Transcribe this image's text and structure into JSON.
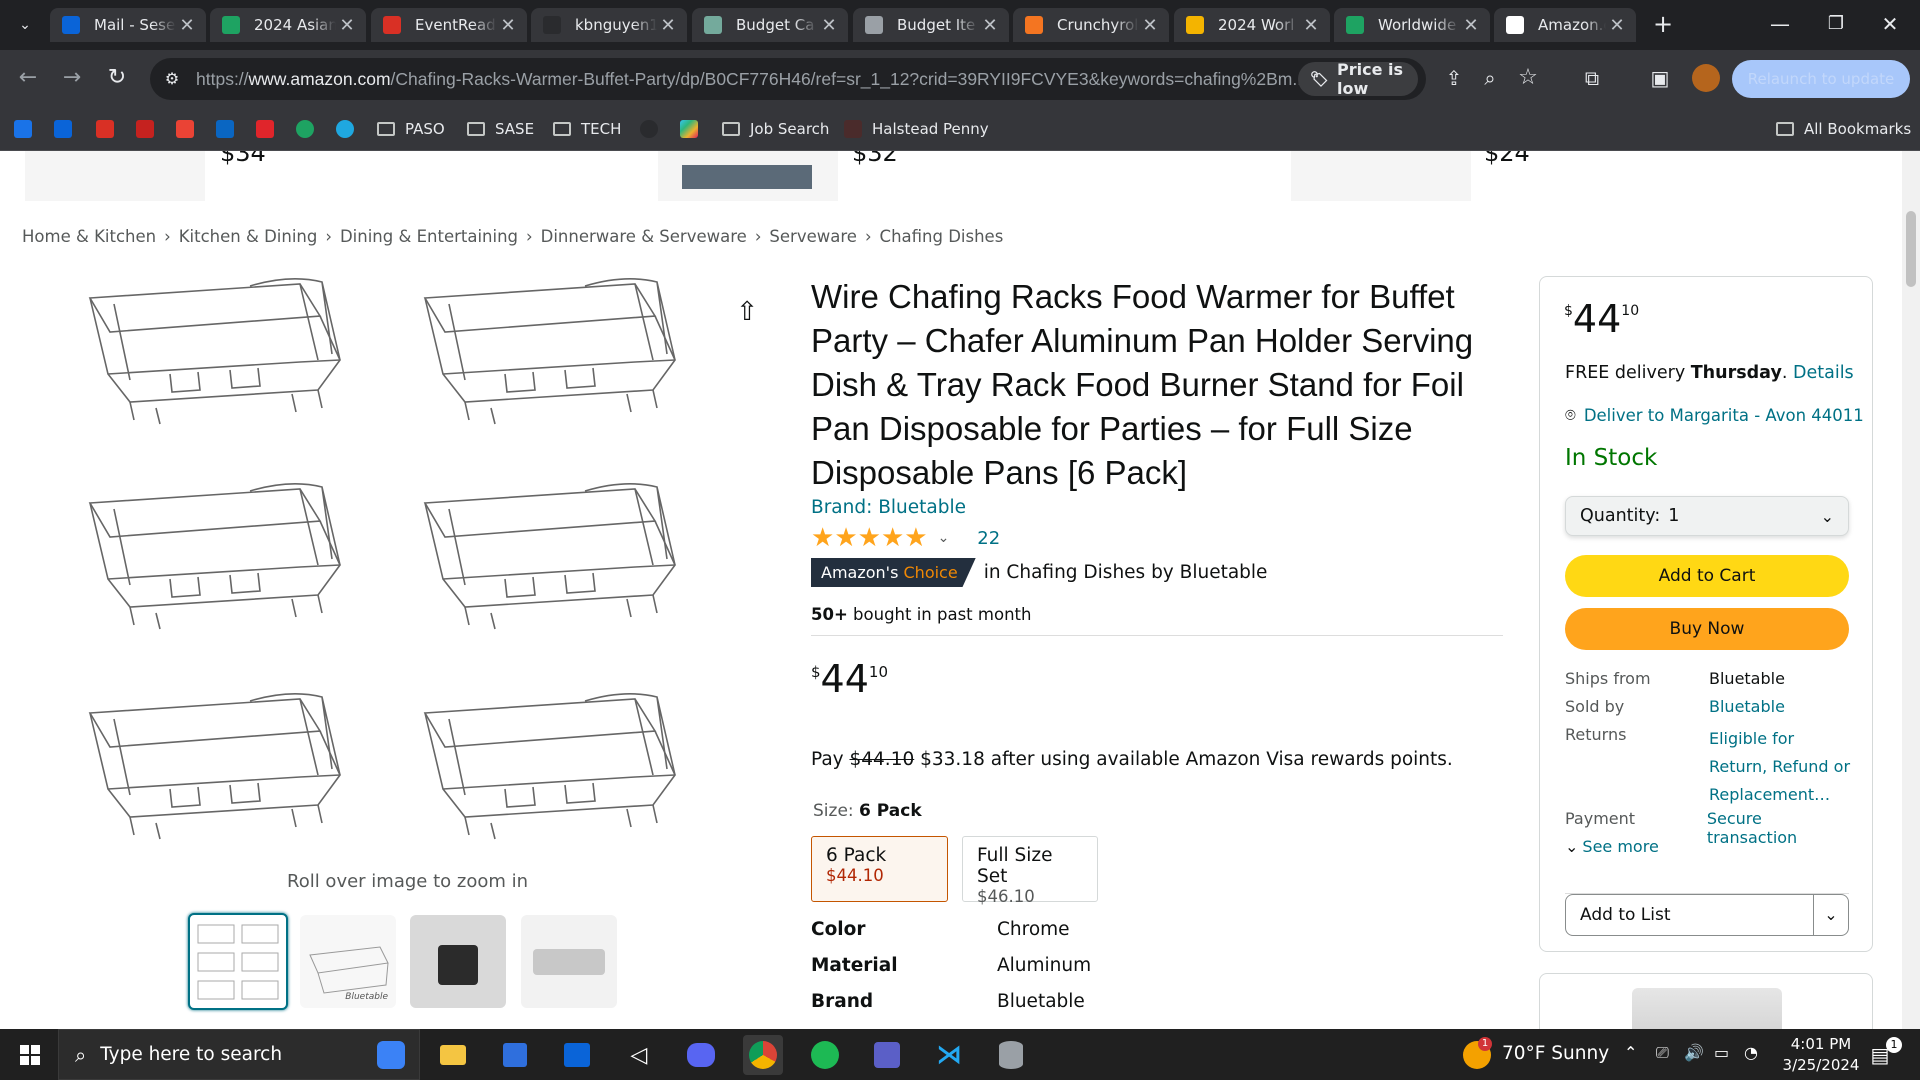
{
  "browser": {
    "tabs": [
      {
        "title": "Mail - Sese",
        "favicon": "outlook-icon",
        "color": "#0a64d8"
      },
      {
        "title": "2024 Asian",
        "favicon": "sheets-icon",
        "color": "#1ea362"
      },
      {
        "title": "EventReady",
        "favicon": "eventready-icon",
        "color": "#d93025"
      },
      {
        "title": "kbnguyen1",
        "favicon": "github-icon",
        "color": "#2a2b2e"
      },
      {
        "title": "Budget Ca",
        "favicon": "chatgpt-icon",
        "color": "#74aa9c"
      },
      {
        "title": "Budget Ite",
        "favicon": "web-icon",
        "color": "#9aa0a6"
      },
      {
        "title": "Crunchyrol",
        "favicon": "crunchyroll-icon",
        "color": "#f47521"
      },
      {
        "title": "2024 Worl",
        "favicon": "drive-icon",
        "color": "#f4b400"
      },
      {
        "title": "Worldwide",
        "favicon": "sheets-icon",
        "color": "#1ea362"
      },
      {
        "title": "Amazon.co",
        "favicon": "amazon-icon",
        "color": "#ffffff",
        "active": true
      }
    ],
    "url_prefix": "https://",
    "url_domain": "www.amazon.com",
    "url_path": "/Chafing-Racks-Warmer-Buffet-Party/dp/B0CF776H46/ref=sr_1_12?crid=39RYII9FCVYE3&keywords=chafing%2Bm...",
    "price_chip": "Price is low",
    "relaunch_label": "Relaunch to update",
    "bookmarks": [
      {
        "label": "PASO",
        "type": "folder"
      },
      {
        "label": "SASE",
        "type": "folder"
      },
      {
        "label": "TECH",
        "type": "folder"
      },
      {
        "label": "Job Search",
        "type": "folder"
      },
      {
        "label": "Halstead Penny",
        "type": "site"
      }
    ],
    "all_bookmarks": "All Bookmarks"
  },
  "top_strip": {
    "prices": [
      "$34",
      "$32",
      "$24"
    ]
  },
  "breadcrumb": [
    "Home & Kitchen",
    "Kitchen & Dining",
    "Dining & Entertaining",
    "Dinnerware & Serveware",
    "Serveware",
    "Chafing Dishes"
  ],
  "gallery": {
    "zoom_hint": "Roll over image to zoom in",
    "thumbnails": [
      "thumbnail-six-racks",
      "thumbnail-rack-dimensions",
      "thumbnail-rack-in-use",
      "thumbnail-foil-pans"
    ],
    "thumb_brand": "Bluetable"
  },
  "product": {
    "title": "Wire Chafing Racks Food Warmer for Buffet Party – Chafer Aluminum Pan Holder Serving Dish & Tray Rack Food Burner Stand for Foil Pan Disposable for Parties – for Full Size Disposable Pans [6 Pack]",
    "brand": "Brand: Bluetable",
    "rating": 5,
    "rating_count": "22",
    "badge_amazons": "Amazon's",
    "badge_choice": "Choice",
    "badge_context": "in Chafing Dishes by Bluetable",
    "bought_bold": "50+",
    "bought_rest": " bought in past month",
    "price_symbol": "$",
    "price_whole": "44",
    "price_fraction": "10",
    "pay_prefix": "Pay ",
    "pay_strike": "$44.10",
    "pay_rest": " $33.18 after using available Amazon Visa rewards points.",
    "size_label": "Size: ",
    "size_selected": "6 Pack",
    "size_options": [
      {
        "name": "6 Pack",
        "price": "$44.10",
        "selected": true
      },
      {
        "name": "Full Size Set",
        "price": "$46.10",
        "selected": false
      }
    ],
    "specs": [
      {
        "label": "Color",
        "value": "Chrome"
      },
      {
        "label": "Material",
        "value": "Aluminum"
      },
      {
        "label": "Brand",
        "value": "Bluetable"
      }
    ]
  },
  "buybox": {
    "price_symbol": "$",
    "price_whole": "44",
    "price_fraction": "10",
    "delivery_prefix": "FREE delivery ",
    "delivery_day": "Thursday",
    "delivery_link": "Details",
    "deliver_to": "Deliver to Margarita - Avon 44011",
    "stock": "In Stock",
    "quantity_label": "Quantity:",
    "quantity_value": "1",
    "add_to_cart": "Add to Cart",
    "buy_now": "Buy Now",
    "details": [
      {
        "label": "Ships from",
        "value": "Bluetable",
        "link": false
      },
      {
        "label": "Sold by",
        "value": "Bluetable",
        "link": true
      },
      {
        "label": "Returns",
        "value": "Eligible for Return, Refund or Replacement…",
        "link": true
      },
      {
        "label": "Payment",
        "value": "Secure transaction",
        "link": true
      }
    ],
    "see_more": "See more",
    "add_to_list": "Add to List",
    "colors": {
      "add_to_cart": "#ffd814",
      "buy_now": "#ffa41c",
      "stock": "#007600"
    }
  },
  "taskbar": {
    "search_placeholder": "Type here to search",
    "weather": "70°F  Sunny",
    "time": "4:01 PM",
    "date": "3/25/2024",
    "notification_count": "1"
  }
}
